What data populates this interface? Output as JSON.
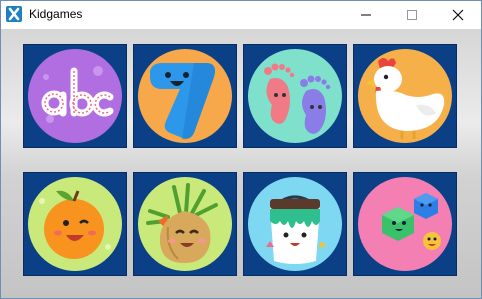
{
  "window": {
    "title": "Kidgames",
    "icon": "app-x-icon",
    "controls": [
      "minimize-icon",
      "maximize-icon",
      "close-icon"
    ]
  },
  "games": [
    {
      "id": "abc",
      "icon": "abc-letters-icon",
      "bg": "#b16ee0"
    },
    {
      "id": "numbers",
      "icon": "number-seven-icon",
      "bg": "#f6a84a"
    },
    {
      "id": "feet",
      "icon": "footprints-icon",
      "bg": "#7fe0cc"
    },
    {
      "id": "chicken",
      "icon": "chicken-icon",
      "bg": "#f6b04a"
    },
    {
      "id": "orange",
      "icon": "orange-fruit-icon",
      "bg": "#c9ea7a"
    },
    {
      "id": "onion",
      "icon": "onion-vegetable-icon",
      "bg": "#c9ea7a"
    },
    {
      "id": "bucket",
      "icon": "paint-bucket-icon",
      "bg": "#7fd8f2"
    },
    {
      "id": "hexagons",
      "icon": "hexagon-shapes-icon",
      "bg": "#f47fb3"
    }
  ]
}
